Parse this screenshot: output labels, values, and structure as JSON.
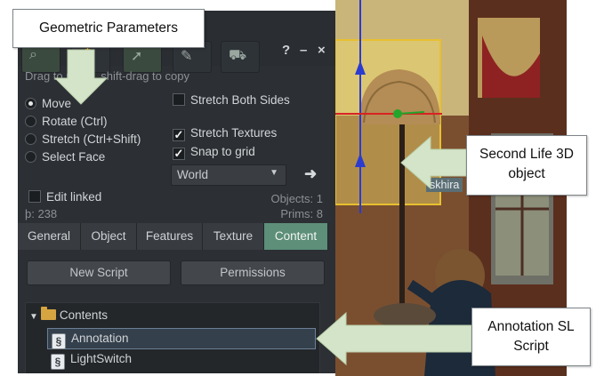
{
  "callouts": {
    "geometric": "Geometric Parameters",
    "object_line1": "Second Life 3D",
    "object_line2": "object",
    "script_line1": "Annotation SL",
    "script_line2": "Script"
  },
  "window_controls": {
    "help": "?",
    "minimize": "–",
    "close": "×"
  },
  "hint": "Drag to move, shift-drag to copy",
  "modes": [
    {
      "label": "Move",
      "selected": true
    },
    {
      "label": "Rotate (Ctrl)",
      "selected": false
    },
    {
      "label": "Stretch (Ctrl+Shift)",
      "selected": false
    },
    {
      "label": "Select Face",
      "selected": false
    }
  ],
  "options": {
    "stretch_both_sides": {
      "label": "Stretch Both Sides",
      "checked": false
    },
    "stretch_textures": {
      "label": "Stretch Textures",
      "checked": true
    },
    "snap_to_grid": {
      "label": "Snap to grid",
      "checked": true
    },
    "edit_linked": {
      "label": "Edit linked",
      "checked": false
    }
  },
  "grid_mode": "World",
  "stats": {
    "objects": "Objects: 1",
    "prims": "Prims: 8",
    "land_impact": "þ: 238"
  },
  "tabs": [
    {
      "label": "General",
      "active": false
    },
    {
      "label": "Object",
      "active": false
    },
    {
      "label": "Features",
      "active": false
    },
    {
      "label": "Texture",
      "active": false
    },
    {
      "label": "Content",
      "active": true
    }
  ],
  "content_buttons": {
    "new_script": "New Script",
    "permissions": "Permissions"
  },
  "inventory": {
    "folder": "Contents",
    "items": [
      {
        "label": "Annotation",
        "selected": true
      },
      {
        "label": "LightSwitch",
        "selected": false
      }
    ]
  },
  "scene": {
    "name_tag": "skhira"
  },
  "colors": {
    "accent_tab": "#5d8f79",
    "panel_bg": "#2c2f33",
    "arrow_fill": "#d4e4c8"
  }
}
